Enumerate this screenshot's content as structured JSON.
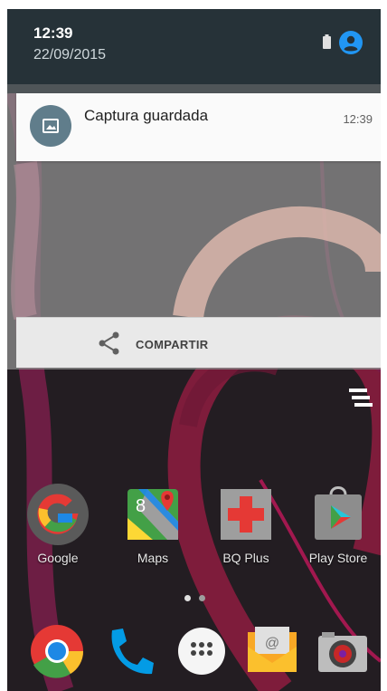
{
  "status": {
    "time": "12:39",
    "date": "22/09/2015",
    "battery_icon": "battery-icon",
    "account_icon": "account-circle-icon",
    "accent": "#2196f3"
  },
  "notification": {
    "icon": "image-icon",
    "title": "Captura guardada",
    "time": "12:39",
    "action_label": "COMPARTIR",
    "action_icon": "share-icon"
  },
  "home": {
    "apps": [
      {
        "label": "Google",
        "icon": "google-icon"
      },
      {
        "label": "Maps",
        "icon": "maps-icon"
      },
      {
        "label": "BQ Plus",
        "icon": "bq-plus-icon"
      },
      {
        "label": "Play Store",
        "icon": "play-store-icon"
      }
    ],
    "dock": [
      "chrome-icon",
      "phone-icon",
      "app-drawer-icon",
      "email-icon",
      "camera-icon"
    ],
    "page_count": 2,
    "current_page": 1
  }
}
